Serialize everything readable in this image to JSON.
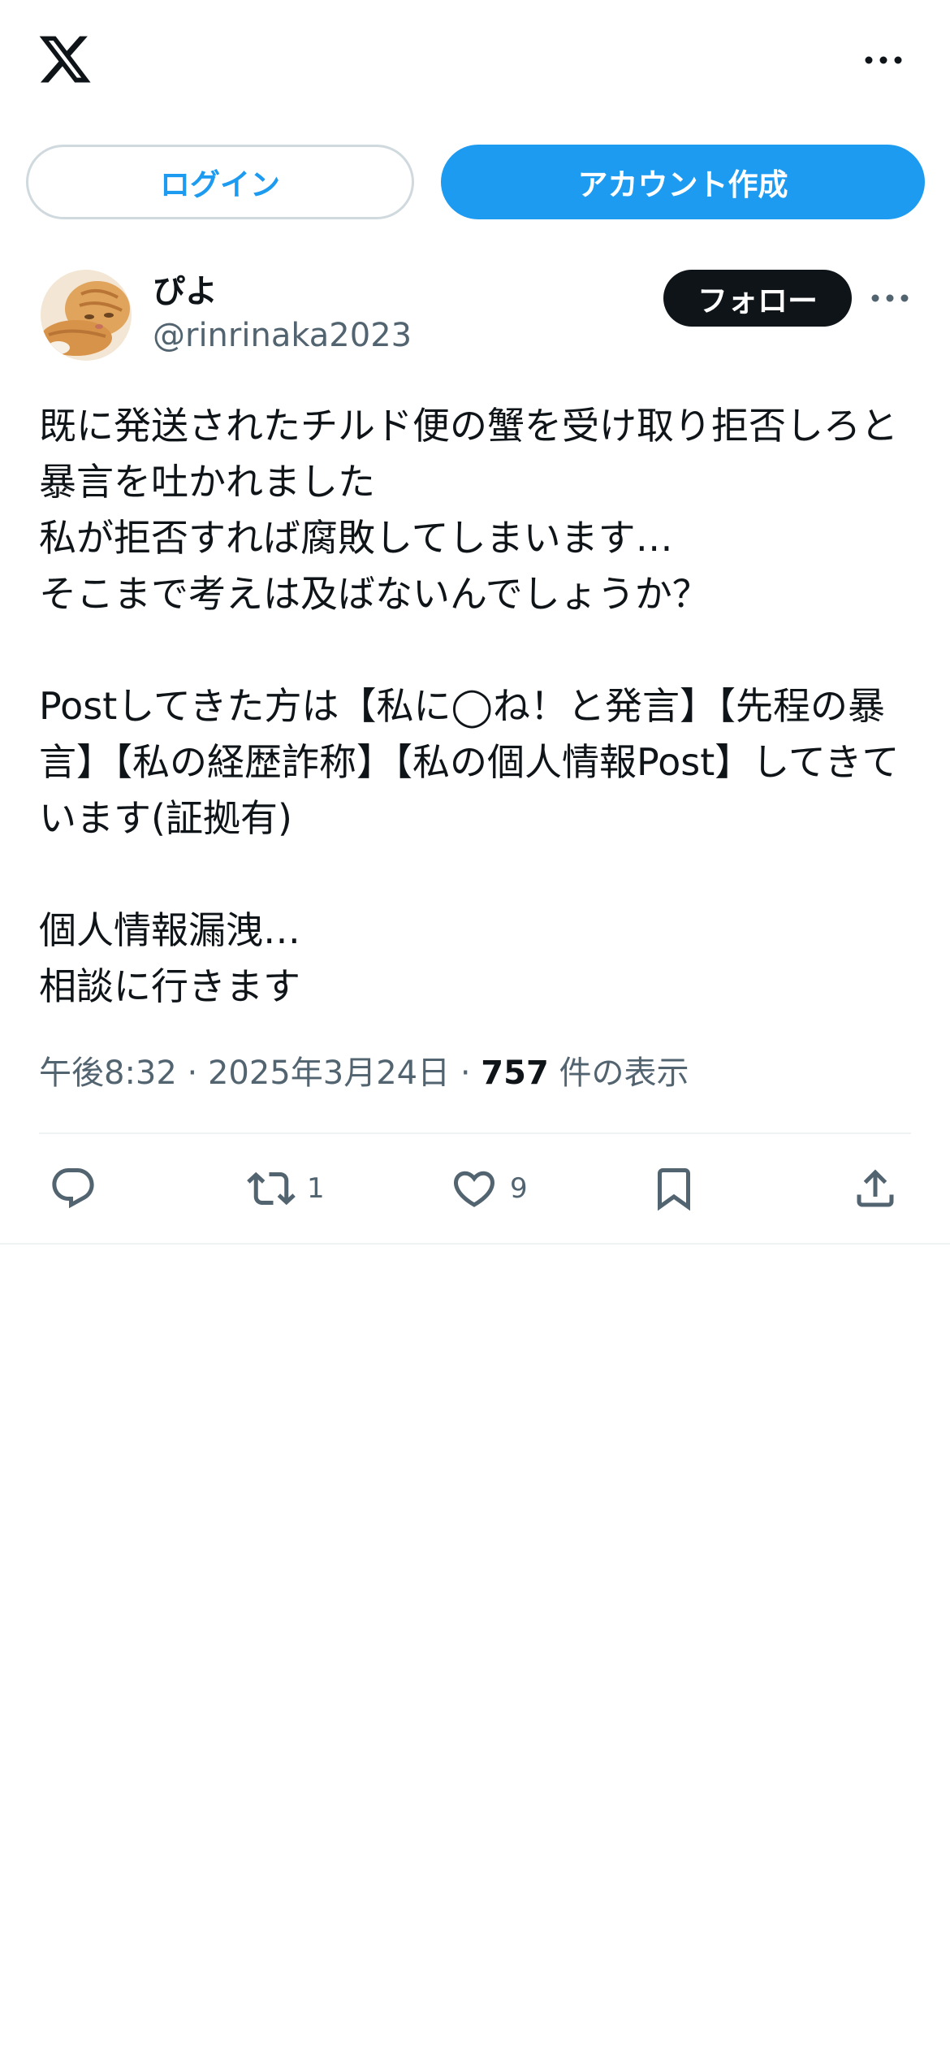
{
  "header": {
    "logo_icon": "x-logo-icon",
    "more_icon": "more-horizontal-icon"
  },
  "auth": {
    "login_label": "ログイン",
    "signup_label": "アカウント作成"
  },
  "post": {
    "display_name": "ぴよ",
    "handle": "@rinrinaka2023",
    "follow_label": "フォロー",
    "text": "既に発送されたチルド便の蟹を受け取り拒否しろと暴言を吐かれました\n私が拒否すれば腐敗してしまいます…\nそこまで考えは及ばないんでしょうか？\n\nPostしてきた方は【私に◯ね！と発言】【先程の暴言】【私の経歴詐称】【私の個人情報Post】してきています(証拠有)\n\n個人情報漏洩…\n相談に行きます",
    "time": "午後8:32",
    "separator": "·",
    "date": "2025年3月24日",
    "views_count": "757",
    "views_label": "件の表示"
  },
  "actions": {
    "reply_count": "",
    "retweet_count": "1",
    "like_count": "9"
  },
  "colors": {
    "accent": "#1d9bf0",
    "text": "#0f1419",
    "secondary": "#536471",
    "border": "#cfd9de"
  }
}
